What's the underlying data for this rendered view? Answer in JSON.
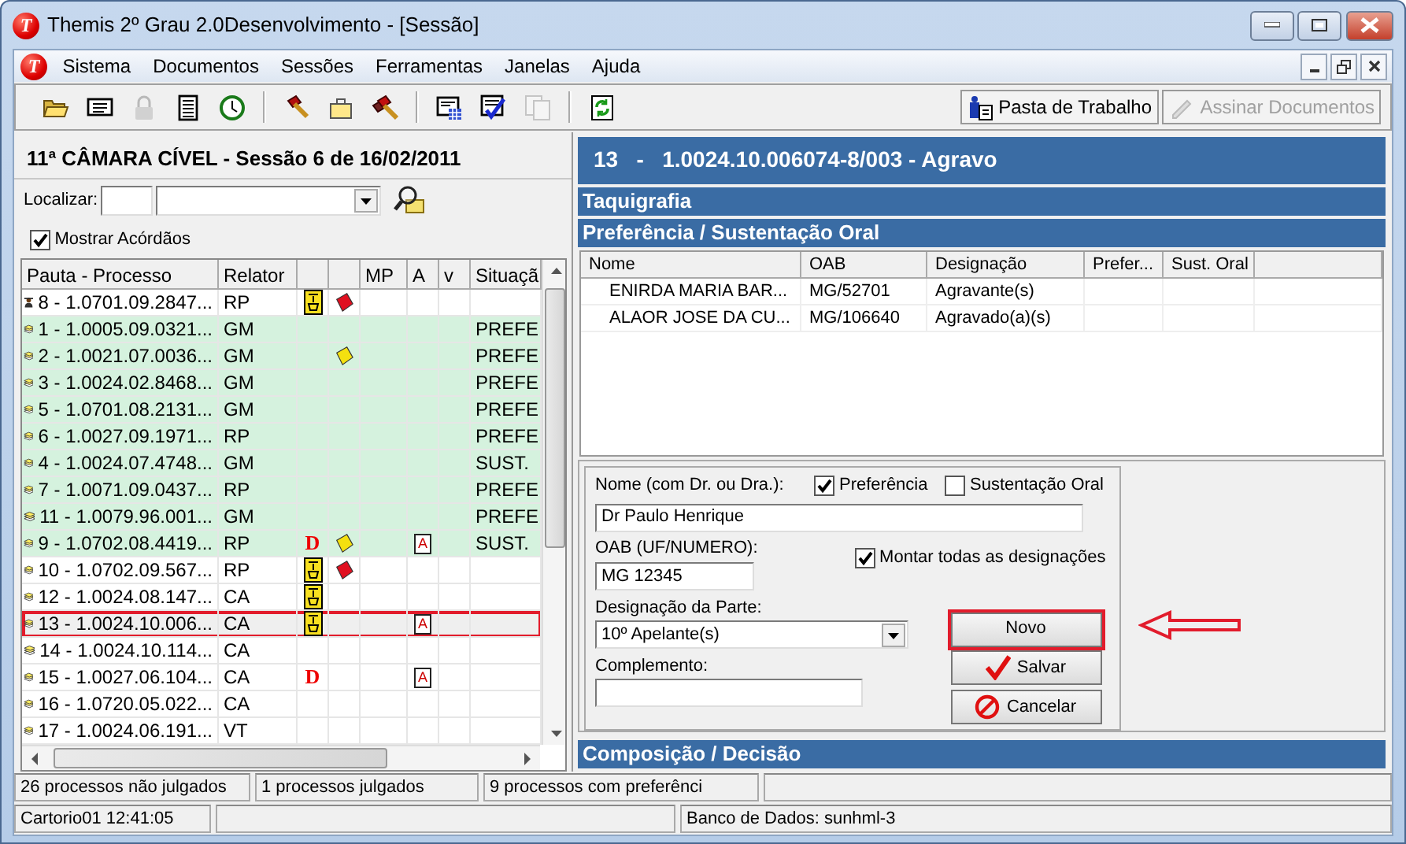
{
  "window": {
    "logo": "T",
    "title": "Themis 2º Grau 2.0Desenvolvimento - [Sessão]"
  },
  "menu": {
    "logo": "T",
    "items": [
      "Sistema",
      "Documentos",
      "Sessões",
      "Ferramentas",
      "Janelas",
      "Ajuda"
    ]
  },
  "toolbar": {
    "tools": [
      {
        "kind": "folder",
        "disabled": false
      },
      {
        "kind": "card",
        "disabled": false
      },
      {
        "kind": "lock",
        "disabled": true
      },
      {
        "kind": "list",
        "disabled": false
      },
      {
        "kind": "clock",
        "disabled": false
      },
      {
        "kind": "separator"
      },
      {
        "kind": "gavel",
        "disabled": false
      },
      {
        "kind": "briefcase",
        "disabled": false
      },
      {
        "kind": "gavels",
        "disabled": false
      },
      {
        "kind": "separator"
      },
      {
        "kind": "calculator",
        "disabled": false
      },
      {
        "kind": "checklist",
        "disabled": false
      },
      {
        "kind": "pages",
        "disabled": true
      },
      {
        "kind": "separator"
      },
      {
        "kind": "refresh",
        "disabled": false
      }
    ],
    "buttons": [
      {
        "kind": "workbook",
        "label": "Pasta de Trabalho",
        "disabled": false
      },
      {
        "kind": "sign",
        "label": "Assinar Documentos",
        "disabled": true
      }
    ]
  },
  "session": {
    "title": "11ª  CÂMARA CÍVEL - Sessão 6 de 16/02/2011",
    "search_label": "Localizar:",
    "show_rulings": {
      "label": "Mostrar Acórdãos",
      "checked": true
    }
  },
  "cases": {
    "columns": [
      {
        "kind": "text",
        "label": "Pauta - Processo"
      },
      {
        "kind": "text",
        "label": "Relator"
      },
      {
        "kind": "blank"
      },
      {
        "kind": "blank"
      },
      {
        "kind": "text",
        "label": "MP"
      },
      {
        "kind": "text",
        "label": "A"
      },
      {
        "kind": "text",
        "label": "v"
      },
      {
        "kind": "text",
        "label": "Situaçã"
      }
    ],
    "rows": [
      {
        "kind": "person",
        "process": "8 - 1.0701.09.2847...",
        "relator": "RP",
        "mark": {
          "kind": "document"
        },
        "flag": {
          "color": "#e01020"
        },
        "preference": false,
        "selected": false
      },
      {
        "kind": "stack",
        "process": "1 - 1.0005.09.0321...",
        "relator": "GM",
        "situation": "PREFE",
        "preference": true,
        "selected": false
      },
      {
        "kind": "stack",
        "process": "2 - 1.0021.07.0036...",
        "relator": "GM",
        "flag": {
          "color": "#f4e010"
        },
        "situation": "PREFE",
        "preference": true,
        "selected": false
      },
      {
        "kind": "stack",
        "process": "3 - 1.0024.02.8468...",
        "relator": "GM",
        "situation": "PREFE",
        "preference": true,
        "selected": false
      },
      {
        "kind": "stack",
        "process": "5 - 1.0701.08.2131...",
        "relator": "GM",
        "situation": "PREFE",
        "preference": true,
        "selected": false
      },
      {
        "kind": "stack",
        "process": "6 - 1.0027.09.1971...",
        "relator": "RP",
        "situation": "PREFE",
        "preference": true,
        "selected": false
      },
      {
        "kind": "stack",
        "process": "4 - 1.0024.07.4748...",
        "relator": "GM",
        "situation": "SUST.",
        "preference": true,
        "selected": false
      },
      {
        "kind": "stack",
        "process": "7 - 1.0071.09.0437...",
        "relator": "RP",
        "situation": "PREFE",
        "preference": true,
        "selected": false
      },
      {
        "kind": "stack",
        "process": "11 - 1.0079.96.001...",
        "relator": "GM",
        "situation": "PREFE",
        "preference": true,
        "selected": false
      },
      {
        "kind": "stack",
        "process": "9 - 1.0702.08.4419...",
        "relator": "RP",
        "mark": {
          "kind": "letter",
          "text": "D"
        },
        "flag": {
          "color": "#f4e010"
        },
        "attachment": "A",
        "situation": "SUST.",
        "preference": true,
        "selected": false
      },
      {
        "kind": "stack",
        "process": "10 - 1.0702.09.567...",
        "relator": "RP",
        "mark": {
          "kind": "document"
        },
        "flag": {
          "color": "#e01020"
        },
        "preference": false,
        "selected": false
      },
      {
        "kind": "stack",
        "process": "12 - 1.0024.08.147...",
        "relator": "CA",
        "mark": {
          "kind": "document"
        },
        "preference": false,
        "selected": false
      },
      {
        "kind": "stack",
        "process": "13 - 1.0024.10.006...",
        "relator": "CA",
        "mark": {
          "kind": "document"
        },
        "attachment": "A",
        "preference": false,
        "selected": true
      },
      {
        "kind": "stack",
        "process": "14 - 1.0024.10.114...",
        "relator": "CA",
        "preference": false,
        "selected": false
      },
      {
        "kind": "stack",
        "process": "15 - 1.0027.06.104...",
        "relator": "CA",
        "mark": {
          "kind": "letter",
          "text": "D"
        },
        "attachment": "A",
        "preference": false,
        "selected": false
      },
      {
        "kind": "stack",
        "process": "16 - 1.0720.05.022...",
        "relator": "CA",
        "preference": false,
        "selected": false
      },
      {
        "kind": "stack",
        "process": "17 - 1.0024.06.191...",
        "relator": "VT",
        "preference": false,
        "selected": false
      }
    ]
  },
  "detail": {
    "header": "13   -   1.0024.10.006074-8/003 - Agravo",
    "sections": [
      "Taquigrafia",
      "Preferência / Sustentação Oral"
    ],
    "parties": {
      "columns": [
        "Nome",
        "OAB",
        "Designação",
        "Prefer...",
        "Sust. Oral"
      ],
      "rows": [
        [
          "ENIRDA MARIA BAR...",
          "MG/52701",
          "Agravante(s)"
        ],
        [
          "ALAOR JOSE DA CU...",
          "MG/106640",
          "Agravado(a)(s)"
        ]
      ]
    },
    "form": {
      "name_label": "Nome (com Dr. ou Dra.):",
      "preference": {
        "label": "Preferência",
        "checked": true
      },
      "oral": {
        "label": "Sustentação Oral",
        "checked": false
      },
      "name_value": "Dr Paulo Henrique",
      "oab_label": "OAB (UF/NUMERO):",
      "oab_value": "MG 12345",
      "all_designations": {
        "label": "Montar todas as designações",
        "checked": true
      },
      "designation_label": "Designação da Parte:",
      "designation_value": "10º Apelante(s)",
      "complement_label": "Complemento:",
      "buttons": [
        {
          "kind": "new",
          "label": "Novo",
          "highlighted": true
        },
        {
          "kind": "save",
          "label": "Salvar",
          "highlighted": false
        },
        {
          "kind": "cancel",
          "label": "Cancelar",
          "highlighted": false
        }
      ]
    },
    "footer_section": "Composição / Decisão"
  },
  "status_bar": {
    "counts": [
      "26 processos não julgados",
      "1 processos julgados",
      "9 processos com preferênci"
    ],
    "user": "Cartorio01  12:41:05",
    "database": "Banco de Dados: sunhml-3"
  }
}
